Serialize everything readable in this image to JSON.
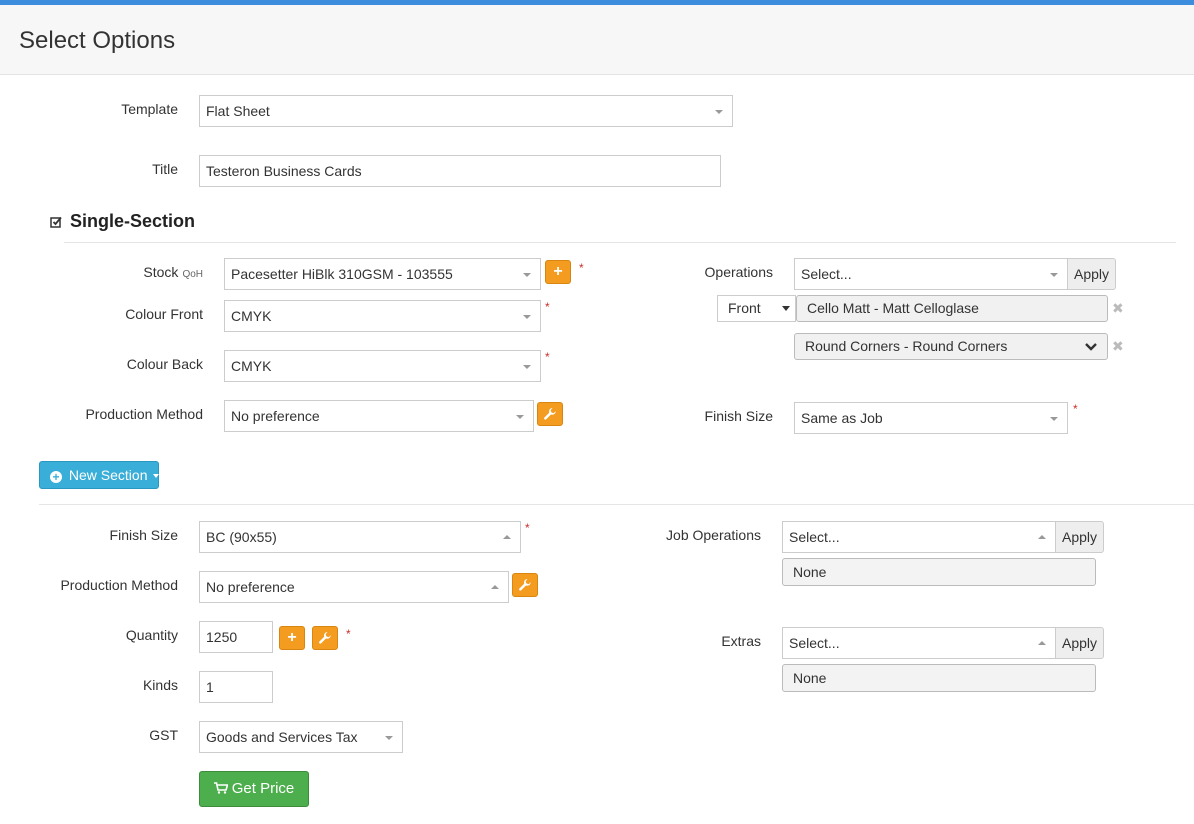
{
  "header": {
    "title": "Select Options"
  },
  "template": {
    "label": "Template",
    "value": "Flat Sheet"
  },
  "title_field": {
    "label": "Title",
    "value": "Testeron Business Cards"
  },
  "section": {
    "heading": "Single-Section",
    "stock": {
      "label": "Stock",
      "qoh": "QoH",
      "value": "Pacesetter HiBlk 310GSM - 103555",
      "add_icon": "+"
    },
    "colour_front": {
      "label": "Colour Front",
      "value": "CMYK"
    },
    "colour_back": {
      "label": "Colour Back",
      "value": "CMYK"
    },
    "production_method": {
      "label": "Production Method",
      "value": "No preference"
    },
    "operations": {
      "label": "Operations",
      "placeholder": "Select...",
      "apply": "Apply",
      "side": "Front",
      "items": [
        "Cello Matt - Matt Celloglase",
        "Round Corners - Round Corners"
      ]
    },
    "finish_size": {
      "label": "Finish Size",
      "value": "Same as Job"
    }
  },
  "new_section_button": "New Section",
  "job": {
    "finish_size": {
      "label": "Finish Size",
      "value": "BC (90x55)"
    },
    "production_method": {
      "label": "Production Method",
      "value": "No preference"
    },
    "quantity": {
      "label": "Quantity",
      "value": "1250"
    },
    "kinds": {
      "label": "Kinds",
      "value": "1"
    },
    "gst": {
      "label": "GST",
      "value": "Goods and Services Tax"
    },
    "job_operations": {
      "label": "Job Operations",
      "placeholder": "Select...",
      "apply": "Apply",
      "none": "None"
    },
    "extras": {
      "label": "Extras",
      "placeholder": "Select...",
      "apply": "Apply",
      "none": "None"
    }
  },
  "get_price_button": "Get Price",
  "required_marker": "*",
  "remove_marker": "✖",
  "colors": {
    "accent": "#3c8dde",
    "orange": "#f39c1f",
    "info": "#39aed8",
    "success": "#4cae4c",
    "required": "#c9302c"
  }
}
